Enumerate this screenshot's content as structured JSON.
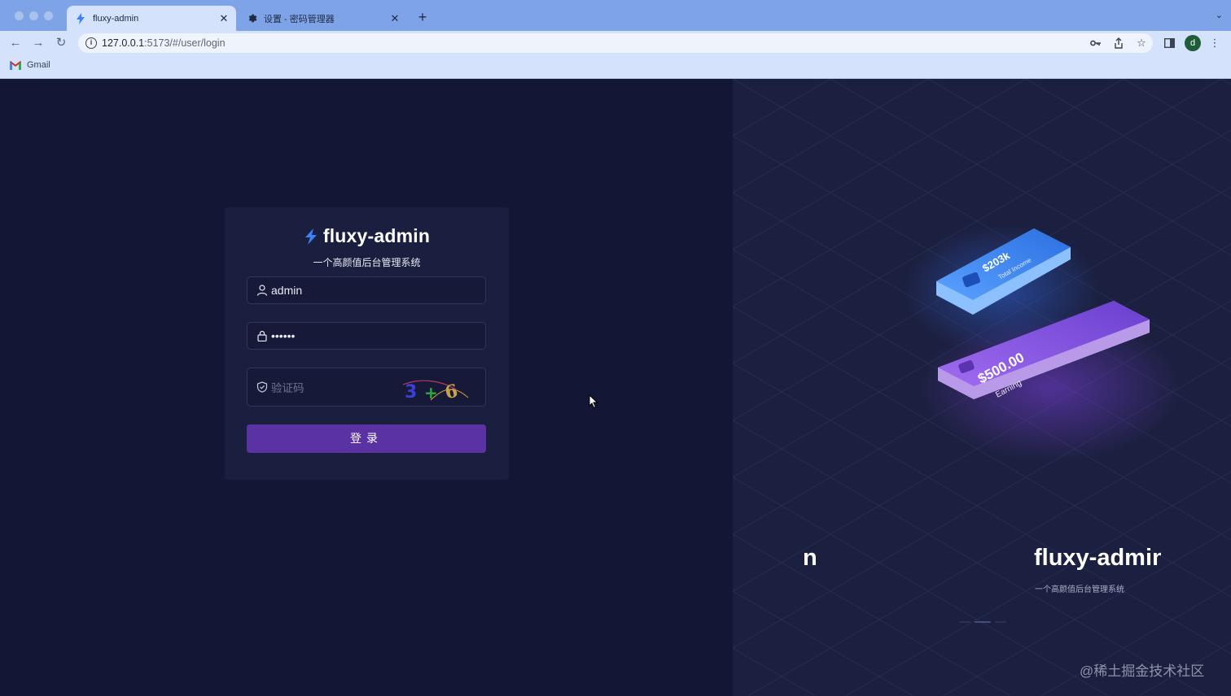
{
  "browser": {
    "tabs": [
      {
        "label": "fluxy-admin",
        "active": true,
        "icon": "bolt-icon"
      },
      {
        "label": "设置 - 密码管理器",
        "active": false,
        "icon": "gear-icon"
      }
    ],
    "url_host": "127.0.0.1",
    "url_path": ":5173/#/user/login",
    "bookmarks": [
      {
        "label": "Gmail",
        "icon": "gmail-icon"
      }
    ],
    "profile_initial": "d"
  },
  "login": {
    "brand_name": "fluxy-admin",
    "subtitle": "一个高颜值后台管理系统",
    "username_value": "admin",
    "password_value": "••••••",
    "captcha_placeholder": "验证码",
    "submit_label": "登录"
  },
  "illustration": {
    "card_top_amount": "$203k",
    "card_top_label": "Total Income",
    "card_bottom_amount": "$500.00",
    "card_bottom_label": "Earning"
  },
  "carousel": {
    "prev_fragment": "n",
    "title": "fluxy-admin",
    "subtitle": "一个高颜值后台管理系统",
    "active_index": 1,
    "count": 3
  },
  "watermark": "@稀土掘金技术社区",
  "colors": {
    "accent": "#5a32a3",
    "page_bg": "#131735",
    "panel_bg": "#1c2040",
    "brand_bolt": "#3b82f6"
  }
}
